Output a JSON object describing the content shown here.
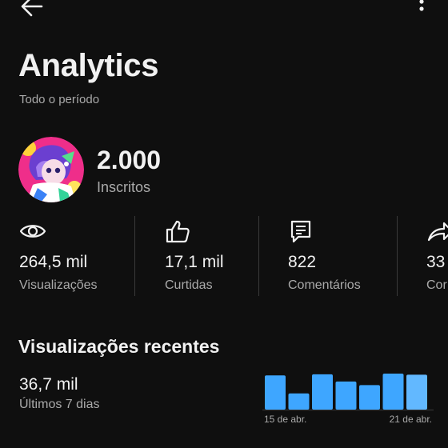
{
  "header": {
    "back_icon": "arrow-left-icon",
    "menu_icon": "more-vertical-icon"
  },
  "page": {
    "title": "Analytics",
    "subtitle": "Todo o período"
  },
  "channel": {
    "avatar_icon": "channel-avatar",
    "subscribers_value": "2.000",
    "subscribers_label": "Inscritos"
  },
  "stats": [
    {
      "icon": "eye-icon",
      "value": "264,5 mil",
      "label": "Visualizações"
    },
    {
      "icon": "thumbs-up-icon",
      "value": "17,1 mil",
      "label": "Curtidas"
    },
    {
      "icon": "comment-icon",
      "value": "822",
      "label": "Comentários"
    },
    {
      "icon": "share-icon",
      "value": "33",
      "label": "Cor"
    }
  ],
  "recent": {
    "title": "Visualizações recentes",
    "value": "36,7 mil",
    "period_label": "Últimos 7 dias"
  },
  "colors": {
    "background": "#0f0f0f",
    "text_primary": "#f1f1f1",
    "text_secondary": "#aaaaaa",
    "bar_color": "#3ea6ff",
    "bar_last_color": "#62b8ff"
  },
  "chart_data": {
    "type": "bar",
    "categories": [
      "15 de abr.",
      "",
      "",
      "",
      "",
      "",
      "21 de abr."
    ],
    "values": [
      0.95,
      0.45,
      0.98,
      0.78,
      0.68,
      1.0,
      0.97
    ],
    "ylim": [
      0,
      1
    ],
    "tick_labels": [
      "15 de abr.",
      "21 de abr."
    ],
    "grid": false
  }
}
